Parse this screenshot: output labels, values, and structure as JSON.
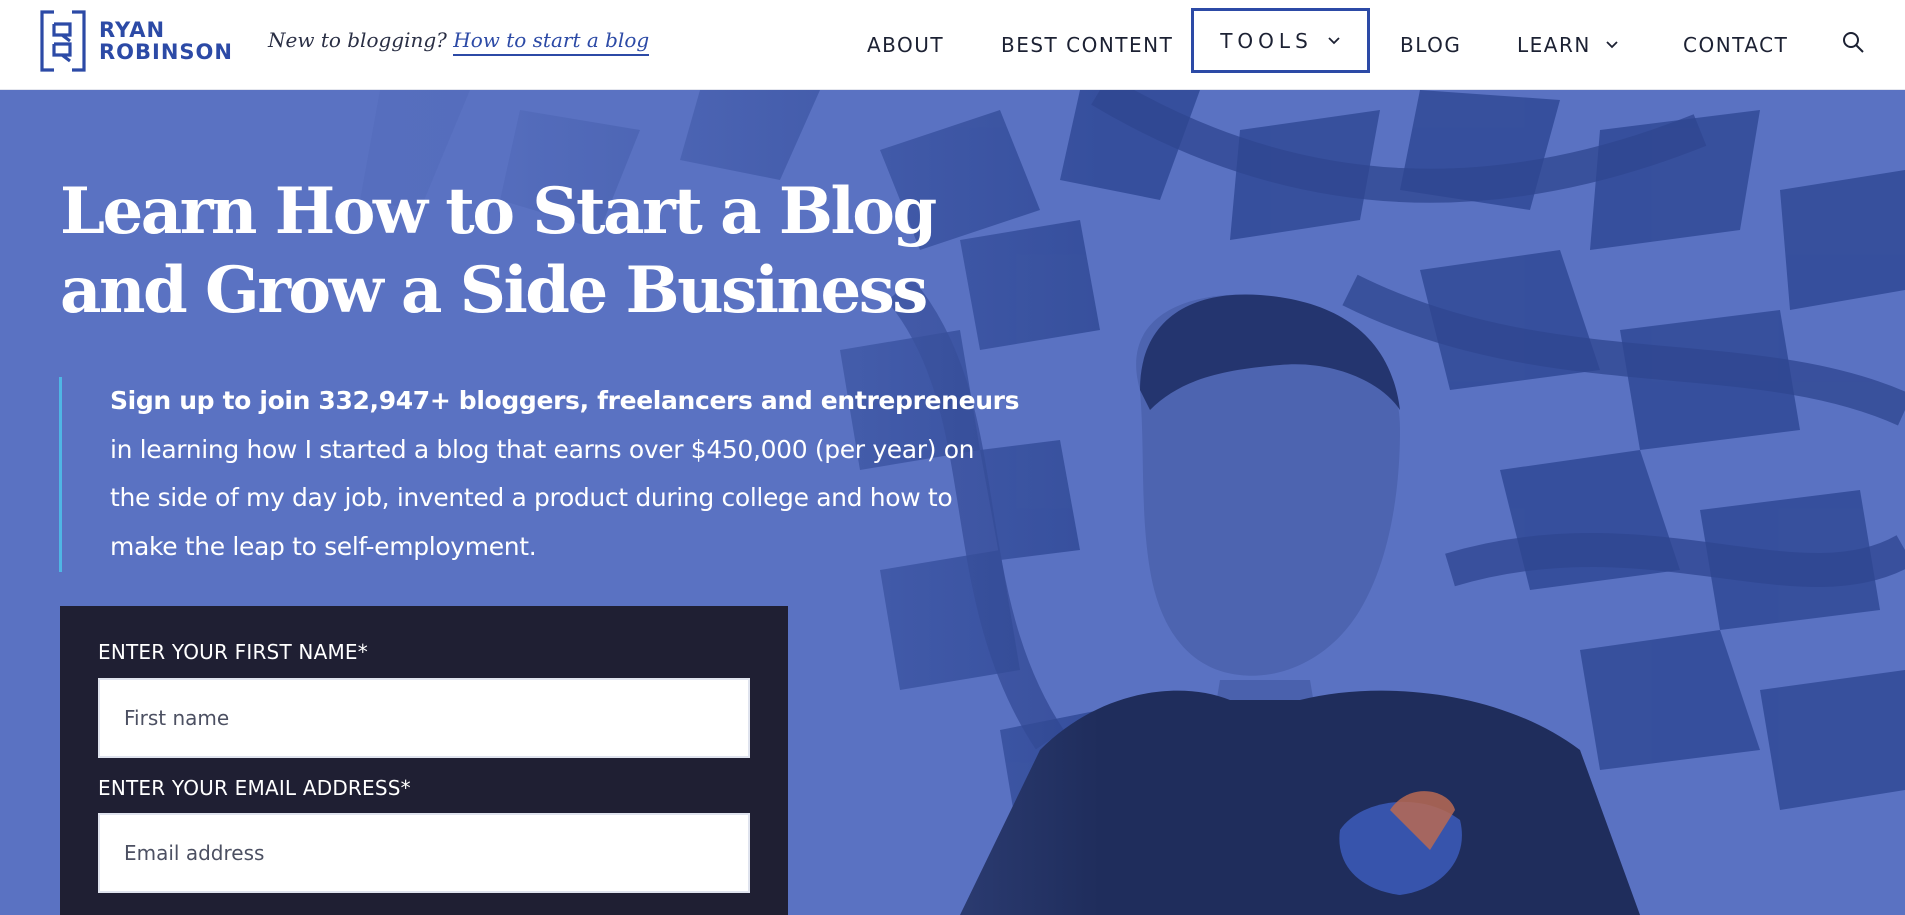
{
  "header": {
    "logo_line1": "RYAN",
    "logo_line2": "ROBINSON",
    "tagline_prefix": "New to blogging?",
    "tagline_link": "How to start a blog"
  },
  "nav": {
    "about": "ABOUT",
    "best_content": "BEST CONTENT",
    "tools": "TOOLS",
    "blog": "BLOG",
    "learn": "LEARN",
    "contact": "CONTACT"
  },
  "hero": {
    "headline_line1": "Learn How to Start a Blog",
    "headline_line2": "and Grow a Side Business",
    "intro_bold": "Sign up to join 332,947+ bloggers, freelancers and entrepreneurs",
    "intro_line2": "in learning how I started a blog that earns over $450,000 (per year) on",
    "intro_line3": "the side of my day job, invented a product during college and how to",
    "intro_line4": "make the leap to self-employment."
  },
  "form": {
    "first_name_label": "ENTER YOUR FIRST NAME*",
    "first_name_placeholder": "First name",
    "email_label": "ENTER YOUR EMAIL ADDRESS*",
    "email_placeholder": "Email address"
  },
  "colors": {
    "brand_blue": "#2c4aa6",
    "hero_overlay": "#5871c0",
    "quote_accent": "#4fb6e4",
    "form_bg": "#1f1f33"
  },
  "icons": [
    "logo-mark-icon",
    "chevron-down-icon",
    "search-icon"
  ]
}
